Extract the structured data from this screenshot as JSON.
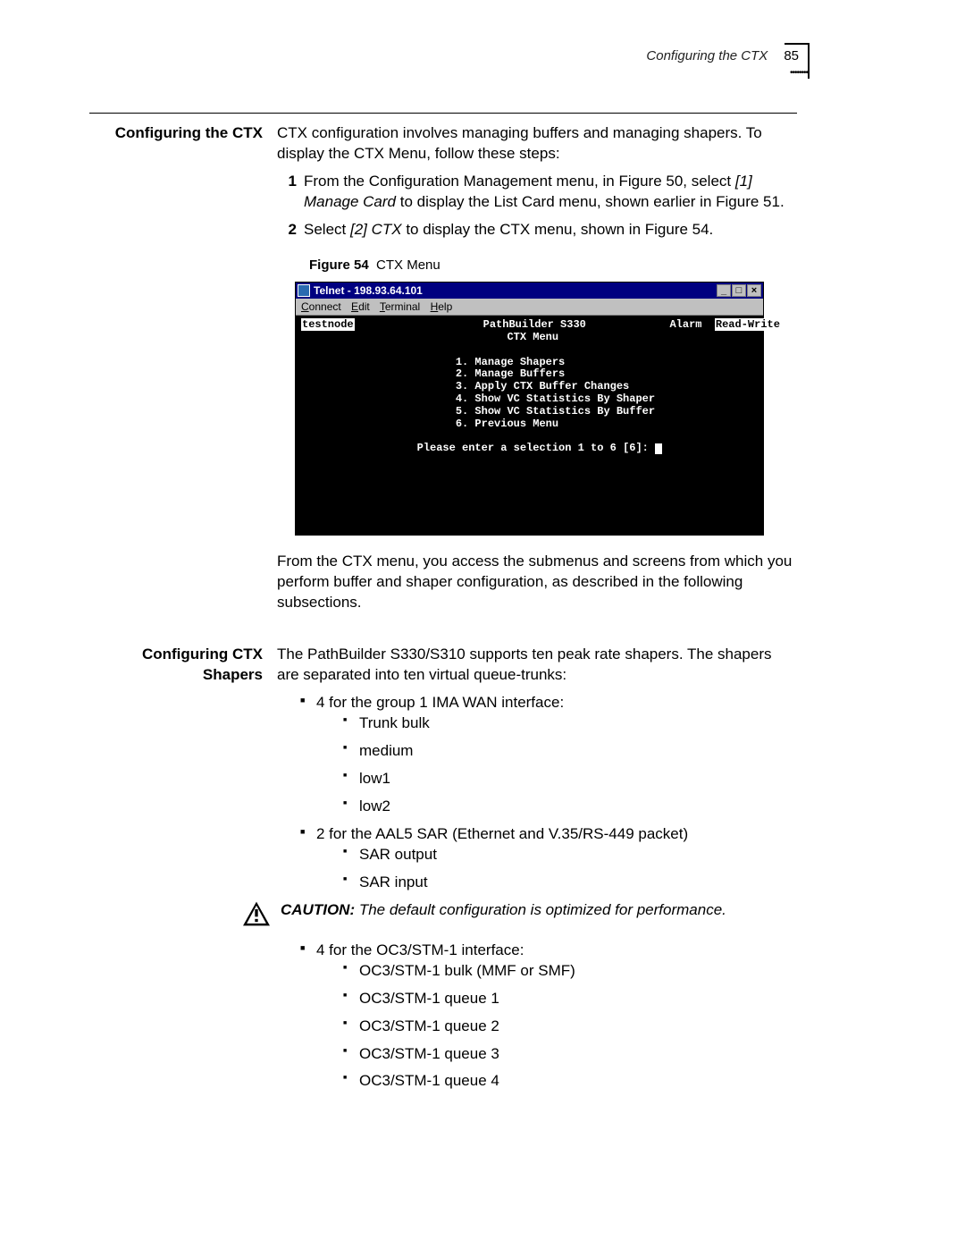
{
  "header": {
    "title": "Configuring the CTX",
    "page": "85"
  },
  "sec1": {
    "heading": "Configuring the CTX",
    "intro": "CTX configuration involves managing buffers and managing shapers. To display the CTX Menu, follow these steps:",
    "step1_num": "1",
    "step1a": "From the Configuration Management menu, in Figure 50, select ",
    "step1_em": "[1] Manage Card",
    "step1b": " to display the List Card menu, shown earlier in Figure 51.",
    "step2_num": "2",
    "step2a": "Select ",
    "step2_em": "[2] CTX",
    "step2b": " to display the CTX menu, shown in Figure 54.",
    "fig_label": "Figure 54",
    "fig_caption": "CTX Menu",
    "after": "From the CTX menu, you access the submenus and screens from which you perform buffer and shaper configuration, as described in the following subsections."
  },
  "telnet": {
    "title": "Telnet - 198.93.64.101",
    "menus": {
      "connect": "Connect",
      "edit": "Edit",
      "terminal": "Terminal",
      "help": "Help"
    },
    "sys": {
      "min": "_",
      "max": "□",
      "close": "×"
    },
    "node": "testnode",
    "device": "PathBuilder S330",
    "alarm": "Alarm",
    "rw": "Read-Write",
    "menu_title": "CTX Menu",
    "items": [
      "1. Manage Shapers",
      "2. Manage Buffers",
      "3. Apply CTX Buffer Changes",
      "4. Show VC Statistics By Shaper",
      "5. Show VC Statistics By Buffer",
      "6. Previous Menu"
    ],
    "prompt": "Please enter a selection 1 to 6 [6]: "
  },
  "sec2": {
    "heading": "Configuring CTX Shapers",
    "intro": "The PathBuilder S330/S310 supports ten peak rate shapers. The shapers are separated into ten virtual queue-trunks:",
    "b1": "4 for the group 1 IMA WAN interface:",
    "b1s": [
      "Trunk bulk",
      "medium",
      "low1",
      "low2"
    ],
    "b2": "2 for the AAL5 SAR (Ethernet and V.35/RS-449 packet)",
    "b2s": [
      "SAR output",
      "SAR input"
    ],
    "caution_label": "CAUTION:",
    "caution_text": " The default configuration is optimized for performance.",
    "b3": "4 for the OC3/STM-1 interface:",
    "b3s": [
      "OC3/STM-1 bulk (MMF or SMF)",
      "OC3/STM-1 queue 1",
      "OC3/STM-1 queue 2",
      "OC3/STM-1 queue 3",
      "OC3/STM-1 queue 4"
    ]
  }
}
